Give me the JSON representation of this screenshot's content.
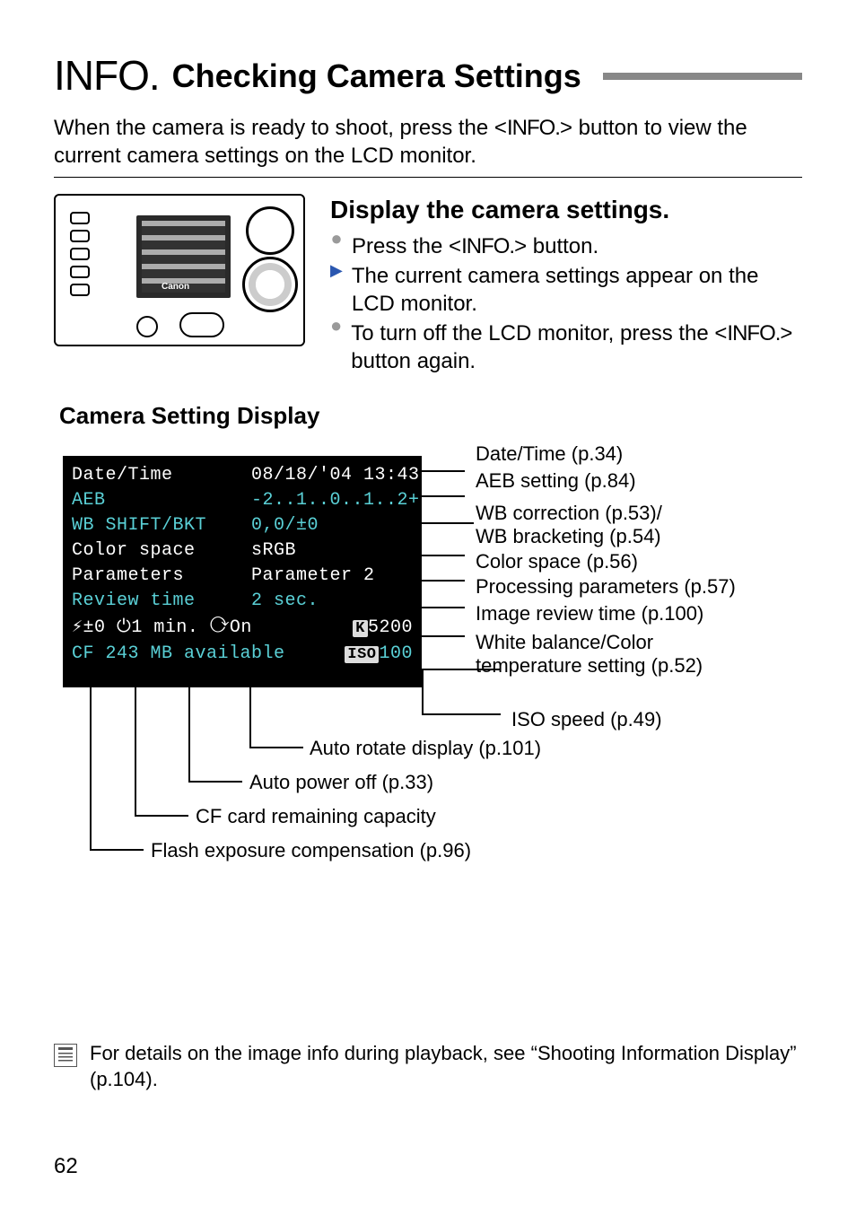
{
  "header": {
    "info_glyph": "INFO.",
    "title": "Checking Camera Settings"
  },
  "intro": {
    "part1": "When the camera is ready to shoot, press the <",
    "info_btn": "INFO.",
    "part2": "> button to view the current camera settings on the LCD monitor."
  },
  "steps": {
    "heading": "Display the camera settings.",
    "items": [
      {
        "bullet": "dot",
        "pre": "Press the <",
        "info": "INFO.",
        "post": "> button."
      },
      {
        "bullet": "tri",
        "text": "The current camera settings appear on the LCD monitor."
      },
      {
        "bullet": "dot",
        "pre": "To turn off the LCD monitor, press the <",
        "info": "INFO.",
        "post": "> button again."
      }
    ]
  },
  "section_heading": "Camera Setting Display",
  "screen": {
    "rows": [
      {
        "label": "Date/Time",
        "value": "08/18/'04 13:43",
        "cyan": false
      },
      {
        "label": "AEB",
        "value": "-2..1..0..1..2+",
        "cyan": true
      },
      {
        "label": "WB SHIFT/BKT",
        "value": "0,0/±0",
        "cyan": true
      },
      {
        "label": "Color space",
        "value": "sRGB",
        "cyan": false
      },
      {
        "label": "Parameters",
        "value": "Parameter 2",
        "cyan": false
      },
      {
        "label": "Review time",
        "value": "2 sec.",
        "cyan": true
      }
    ],
    "bottom1": {
      "left": "⚡±0 ⏻1 min. ⟳On",
      "right_tag": "K",
      "right_val": "5200"
    },
    "bottom2": {
      "left": "CF 243 MB available",
      "right_tag": "ISO",
      "right_val": "100"
    }
  },
  "annotations_right": [
    "Date/Time (p.34)",
    "AEB setting (p.84)",
    "WB correction (p.53)/",
    "WB bracketing (p.54)",
    "Color space (p.56)",
    "Processing parameters (p.57)",
    "Image review time (p.100)",
    "White balance/Color",
    "temperature setting (p.52)",
    "ISO speed (p.49)"
  ],
  "annotations_bottom": [
    "Auto rotate display (p.101)",
    "Auto power off (p.33)",
    "CF card remaining capacity",
    "Flash exposure compensation (p.96)"
  ],
  "note": "For details on the image info during playback, see “Shooting Information Display” (p.104).",
  "page_number": "62"
}
